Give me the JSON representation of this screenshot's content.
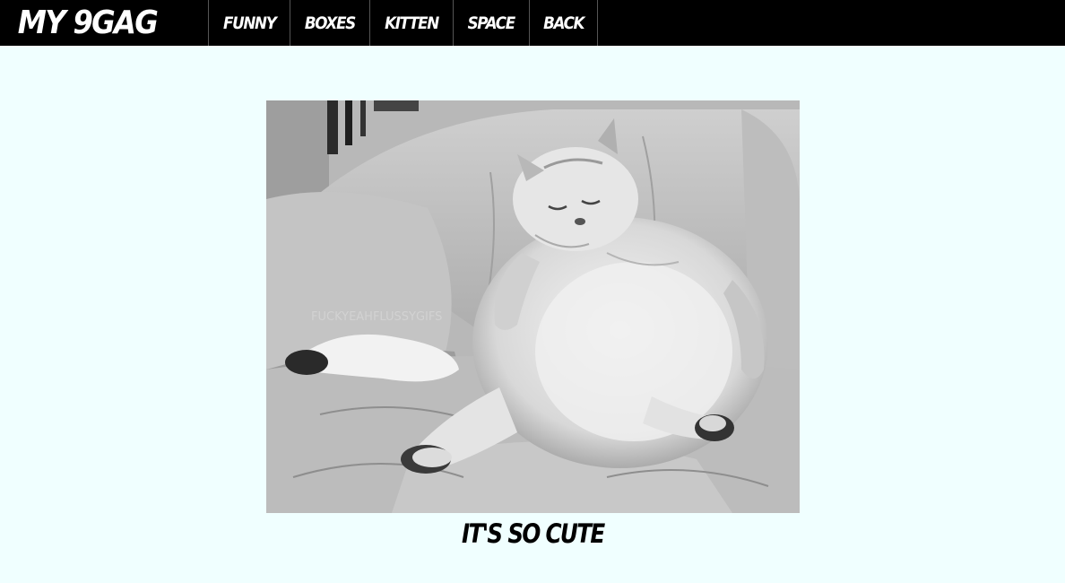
{
  "header": {
    "brand": "MY 9GAG",
    "nav": [
      {
        "label": "FUNNY"
      },
      {
        "label": "BOXES"
      },
      {
        "label": "KITTEN"
      },
      {
        "label": "SPACE"
      },
      {
        "label": "BACK"
      }
    ]
  },
  "main": {
    "image_watermark": "FUCKYEAHFLUSSYGIFS",
    "caption": "IT'S SO CUTE"
  },
  "colors": {
    "page_background": "#f0ffff",
    "header_background": "#000000",
    "header_text": "#ffffff"
  },
  "icons": {
    "main_image": "fat-cat-photo"
  }
}
